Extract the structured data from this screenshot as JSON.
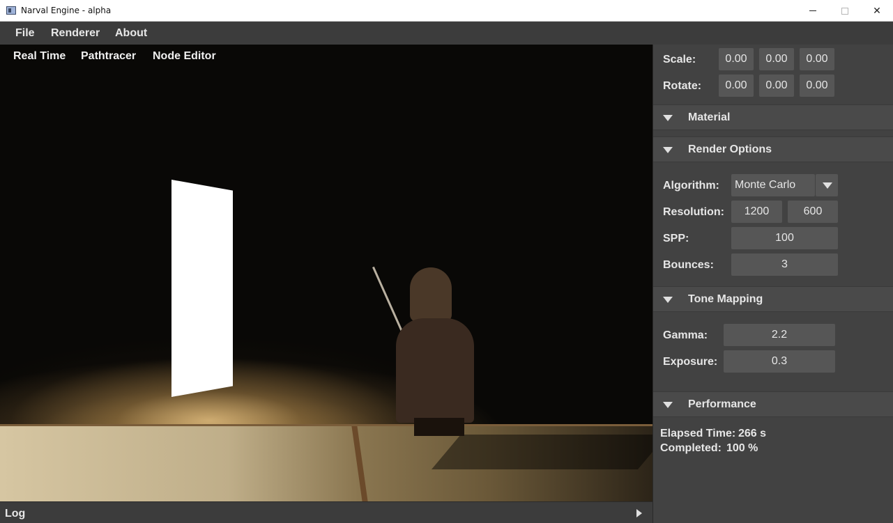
{
  "window": {
    "title": "Narval Engine - alpha",
    "icon": "app-window-icon"
  },
  "menu": {
    "file": "File",
    "renderer": "Renderer",
    "about": "About"
  },
  "viewport_tabs": {
    "real_time": "Real Time",
    "pathtracer": "Pathtracer",
    "node_editor": "Node Editor"
  },
  "log": {
    "label": "Log",
    "arrow_icon": "triangle-right-icon"
  },
  "transform": {
    "scale_label": "Scale:",
    "scale": [
      "0.00",
      "0.00",
      "0.00"
    ],
    "rotate_label": "Rotate:",
    "rotate": [
      "0.00",
      "0.00",
      "0.00"
    ]
  },
  "sections": {
    "material": "Material",
    "render_options": "Render Options",
    "tone_mapping": "Tone Mapping",
    "performance": "Performance"
  },
  "render_options": {
    "algorithm_label": "Algorithm:",
    "algorithm_value": "Monte Carlo",
    "resolution_label": "Resolution:",
    "resolution_w": "1200",
    "resolution_h": "600",
    "spp_label": "SPP:",
    "spp": "100",
    "bounces_label": "Bounces:",
    "bounces": "3"
  },
  "tone_mapping": {
    "gamma_label": "Gamma:",
    "gamma": "2.2",
    "exposure_label": "Exposure:",
    "exposure": "0.3"
  },
  "performance": {
    "elapsed_label": "Elapsed Time:",
    "elapsed_value": "266 s",
    "completed_label": "Completed:",
    "completed_value": "100 %"
  },
  "colors": {
    "panel_bg": "#424242",
    "section_bg": "#4a4a4a",
    "field_bg": "#565656",
    "menubar_bg": "#3c3c3c"
  }
}
